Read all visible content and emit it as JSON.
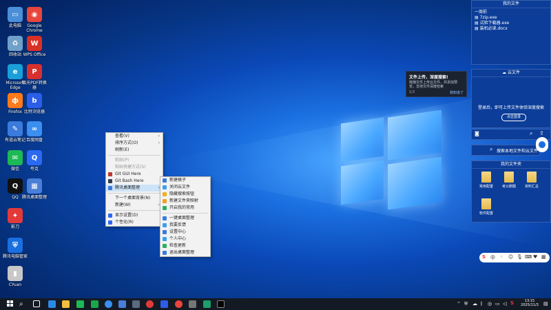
{
  "desktop_icons": [
    {
      "label": "此电脑",
      "color": "#4a8fd8",
      "glyph": "▭"
    },
    {
      "label": "Google Chrome",
      "color": "#e8453c",
      "glyph": "◉"
    },
    {
      "label": "回收站",
      "color": "#6fa0c8",
      "glyph": "♻"
    },
    {
      "label": "WPS Office",
      "color": "#d93025",
      "glyph": "W"
    },
    {
      "label": "Microsoft Edge",
      "color": "#1a9fd8",
      "glyph": "e"
    },
    {
      "label": "极光PDF转换器",
      "color": "#d8302e",
      "glyph": "P"
    },
    {
      "label": "Firefox",
      "color": "#ff7a1a",
      "glyph": "ф"
    },
    {
      "label": "比特浏览器",
      "color": "#2b5de8",
      "glyph": "b"
    },
    {
      "label": "有道云笔记",
      "color": "#3a7bdc",
      "glyph": "✎"
    },
    {
      "label": "百度网盘",
      "color": "#3a8ff0",
      "glyph": "∞"
    },
    {
      "label": "微信",
      "color": "#1db954",
      "glyph": "✉"
    },
    {
      "label": "夸克",
      "color": "#2b6af0",
      "glyph": "Q"
    },
    {
      "label": "QQ",
      "color": "#111111",
      "glyph": "Q"
    },
    {
      "label": "腾讯桌面整理",
      "color": "#4a7fd8",
      "glyph": "▦"
    },
    {
      "label": "影刀",
      "color": "#e23a3a",
      "glyph": "✦"
    },
    {
      "label": "腾讯电脑管家",
      "color": "#1a6fe0",
      "glyph": "⛨"
    },
    {
      "label": "CYuan",
      "color": "#c8c8c8",
      "glyph": "▮"
    }
  ],
  "context_menu": {
    "items": [
      {
        "label": "查看(V)",
        "arrow": true,
        "disabled": false
      },
      {
        "label": "排序方式(O)",
        "arrow": true,
        "disabled": false
      },
      {
        "label": "刷新(E)",
        "arrow": false,
        "disabled": false
      },
      {
        "sep": true
      },
      {
        "label": "粘贴(P)",
        "arrow": false,
        "disabled": true
      },
      {
        "label": "粘贴快捷方式(S)",
        "arrow": false,
        "disabled": true
      },
      {
        "label": "Git GUI Here",
        "arrow": false,
        "disabled": false,
        "icon": "#c0392b"
      },
      {
        "label": "Git Bash Here",
        "arrow": false,
        "disabled": false,
        "icon": "#2c3e50"
      },
      {
        "label": "腾讯桌面整理",
        "arrow": true,
        "disabled": false,
        "icon": "#3a7bdc",
        "highlight": true
      },
      {
        "sep": true
      },
      {
        "label": "下一个桌面背景(N)",
        "arrow": false,
        "disabled": false
      },
      {
        "label": "新建(W)",
        "arrow": true,
        "disabled": false
      },
      {
        "sep": true
      },
      {
        "label": "显示设置(D)",
        "arrow": false,
        "disabled": false,
        "icon": "#2b6af0"
      },
      {
        "label": "个性化(R)",
        "arrow": false,
        "disabled": false,
        "icon": "#2b6af0"
      }
    ]
  },
  "submenu": {
    "items": [
      {
        "label": "新建格子",
        "icon": "#3a7bdc"
      },
      {
        "label": "关闭云文件",
        "icon": "#3a9ff0"
      },
      {
        "label": "隐藏搜索按钮",
        "icon": "#f0b020"
      },
      {
        "label": "新建文件夹映射",
        "icon": "#f0a020"
      },
      {
        "label": "开启我的常用",
        "icon": "#2bb060"
      },
      {
        "sep": true
      },
      {
        "label": "一键桌面整理",
        "icon": "#3a7bdc"
      },
      {
        "label": "我要反馈",
        "icon": "#3a9ff0"
      },
      {
        "label": "设置中心",
        "icon": "#3a7bdc"
      },
      {
        "label": "个人中心",
        "icon": "#3a9ff0"
      },
      {
        "label": "检查更新",
        "icon": "#2bb060"
      },
      {
        "label": "退出桌面整理",
        "icon": "#3a7bdc"
      }
    ]
  },
  "notification": {
    "title": "文件上传，深度搜索!",
    "desc": "拖拽文件上传云文件，并添加预览，支持文件深度检索",
    "page": "1/3",
    "action": "我知道了"
  },
  "recent_panel": {
    "title": "我的文件",
    "section": "一周前",
    "files": [
      "7zip.exe",
      "试验下载器.exe",
      "装机必读.docx"
    ]
  },
  "cloud_panel": {
    "title": "云文件",
    "message": "登录后，即可上传文件体验深度搜索",
    "button": "点击登录"
  },
  "search": {
    "placeholder": "搜索本地文件和云文件"
  },
  "folders_panel": {
    "title": "我的文件夹",
    "folders": [
      "常用配置",
      "考公刷题",
      "资料汇总",
      "软件配置"
    ]
  },
  "ime": {
    "label": "中"
  },
  "clock": {
    "time": "13:15",
    "date": "2025/11/3"
  },
  "colors": {
    "accent": "#0b49b8",
    "panel": "#0c3d99",
    "taskbar": "#141a24"
  }
}
